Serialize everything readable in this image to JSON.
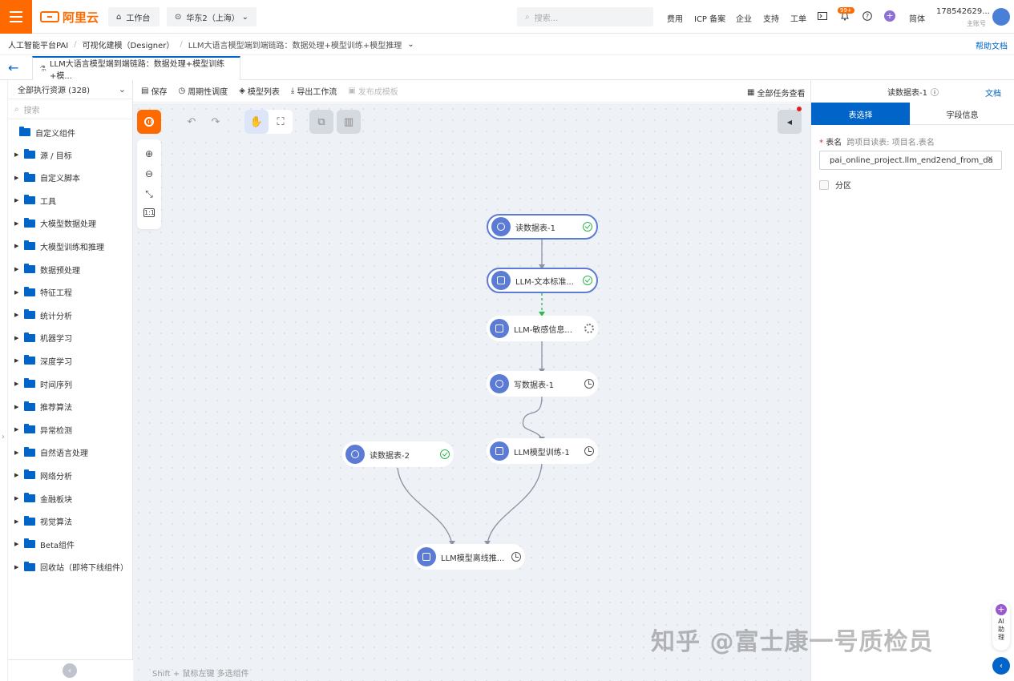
{
  "topbar": {
    "logo": "阿里云",
    "workbench": "工作台",
    "region": "华东2（上海）",
    "search_placeholder": "搜索...",
    "nav": [
      "费用",
      "ICP 备案",
      "企业",
      "支持",
      "工单"
    ],
    "badge": "99+",
    "lang": "简体",
    "account": "178542629...",
    "account_sub": "主账号"
  },
  "breadcrumb": {
    "items": [
      "人工智能平台PAI",
      "可视化建模（Designer）",
      "LLM大语言模型端到端链路：数据处理+模型训练+模型推理"
    ],
    "help": "帮助文档"
  },
  "tab": {
    "label": "LLM大语言模型端到端链路：数据处理+模型训练+模..."
  },
  "left": {
    "resource_picker": "全部执行资源 (328)",
    "search_placeholder": "搜索",
    "custom": "自定义组件",
    "folders": [
      "源 / 目标",
      "自定义脚本",
      "工具",
      "大模型数据处理",
      "大模型训练和推理",
      "数据预处理",
      "特征工程",
      "统计分析",
      "机器学习",
      "深度学习",
      "时间序列",
      "推荐算法",
      "异常检测",
      "自然语言处理",
      "网络分析",
      "金融板块",
      "视觉算法",
      "Beta组件",
      "回收站（即将下线组件）"
    ]
  },
  "toolbar": {
    "save": "保存",
    "schedule": "周期性调度",
    "model_list": "模型列表",
    "export": "导出工作流",
    "publish": "发布成模板",
    "all_tasks": "全部任务查看"
  },
  "nodes": [
    {
      "label": "读数据表-1",
      "status": "success"
    },
    {
      "label": "LLM-文本标准...",
      "status": "success"
    },
    {
      "label": "LLM-敏感信息...",
      "status": "running"
    },
    {
      "label": "写数据表-1",
      "status": "waiting"
    },
    {
      "label": "LLM模型训练-1",
      "status": "waiting"
    },
    {
      "label": "读数据表-2",
      "status": "success"
    },
    {
      "label": "LLM模型离线推...",
      "status": "waiting"
    }
  ],
  "canvas_hint": "Shift + 鼠标左键 多选组件",
  "right": {
    "title": "读数据表-1",
    "doc": "文档",
    "tab_active": "表选择",
    "tab_inactive": "字段信息",
    "table_label": "表名",
    "table_hint": "跨项目读表: 项目名.表名",
    "table_value": "pai_online_project.llm_end2end_from_da",
    "partition": "分区"
  },
  "ai": {
    "label1": "AI",
    "label2": "助",
    "label3": "理"
  },
  "watermark": "知乎 @富士康一号质检员",
  "colors": {
    "brand": "#ff6a00",
    "accent": "#0064c8",
    "node": "#5b7bd5",
    "success": "#2db84d"
  }
}
